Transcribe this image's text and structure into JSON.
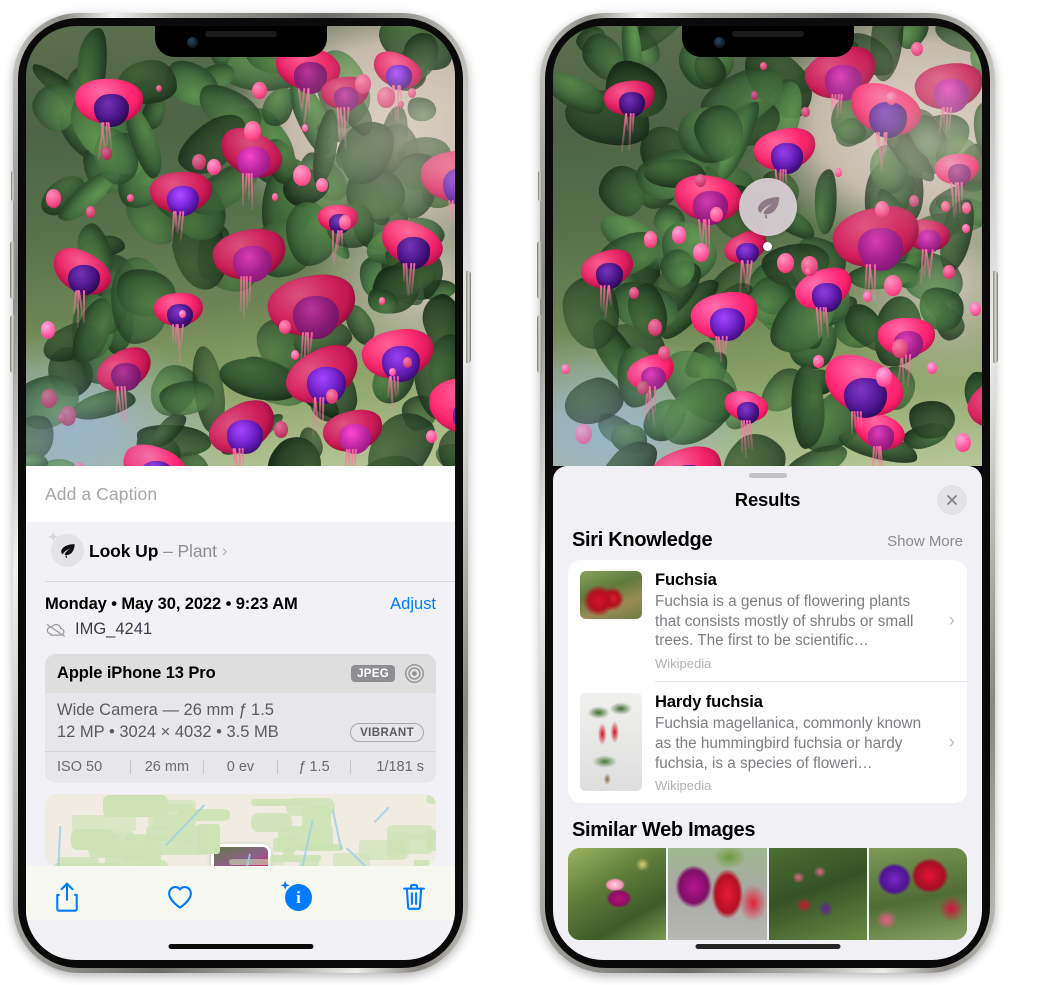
{
  "left_phone": {
    "name": "photos-detail-view",
    "caption": {
      "placeholder": "Add a Caption",
      "value": ""
    },
    "lookup": {
      "icon": "leaf-icon",
      "sparkle_icon": "sparkle-icon",
      "label": "Look Up",
      "separator": "–",
      "subject": "Plant",
      "chevron": "›"
    },
    "metadata": {
      "date_line": "Monday • May 30, 2022 • 9:23 AM",
      "adjust_label": "Adjust",
      "cloud_icon": "icloud-slash-icon",
      "filename": "IMG_4241"
    },
    "exif": {
      "device": "Apple iPhone 13 Pro",
      "format_badge": "JPEG",
      "aperture_icon": "aperture-icon",
      "lens_line": "Wide Camera — 26 mm ƒ 1.5",
      "size_line": "12 MP • 3024 × 4032 • 3.5 MB",
      "style_badge": "VIBRANT",
      "stats": [
        "ISO 50",
        "26 mm",
        "0 ev",
        "ƒ 1.5",
        "1/181 s"
      ]
    },
    "map": {
      "name": "location-map-card"
    },
    "toolbar": [
      {
        "name": "share-button",
        "icon": "share-icon"
      },
      {
        "name": "favorite-button",
        "icon": "heart-icon"
      },
      {
        "name": "info-button",
        "icon": "info-circle-icon"
      },
      {
        "name": "delete-button",
        "icon": "trash-icon"
      }
    ]
  },
  "right_phone": {
    "name": "visual-lookup-results",
    "badge": {
      "icon": "leaf-icon",
      "name": "visual-lookup-badge"
    },
    "sheet": {
      "grabber": "drag-handle",
      "title": "Results",
      "close_icon": "close-icon"
    },
    "siri_knowledge": {
      "title": "Siri Knowledge",
      "action": "Show More",
      "items": [
        {
          "title": "Fuchsia",
          "description": "Fuchsia is a genus of flowering plants that consists mostly of shrubs or small trees. The first to be scientific…",
          "source": "Wikipedia",
          "chevron": "›"
        },
        {
          "title": "Hardy fuchsia",
          "description": "Fuchsia magellanica, commonly known as the hummingbird fuchsia or hardy fuchsia, is a species of floweri…",
          "source": "Wikipedia",
          "chevron": "›"
        }
      ]
    },
    "similar_web_images": {
      "title": "Similar Web Images",
      "thumbnails": [
        "web-image-1",
        "web-image-2",
        "web-image-3",
        "web-image-4"
      ]
    }
  },
  "colors": {
    "accent_blue": "#007aff",
    "sheet_bg": "#f1f1f5",
    "card_bg": "#ffffff",
    "secondary_text": "#8e8e93",
    "exif_bg": "#e6e6eb"
  }
}
